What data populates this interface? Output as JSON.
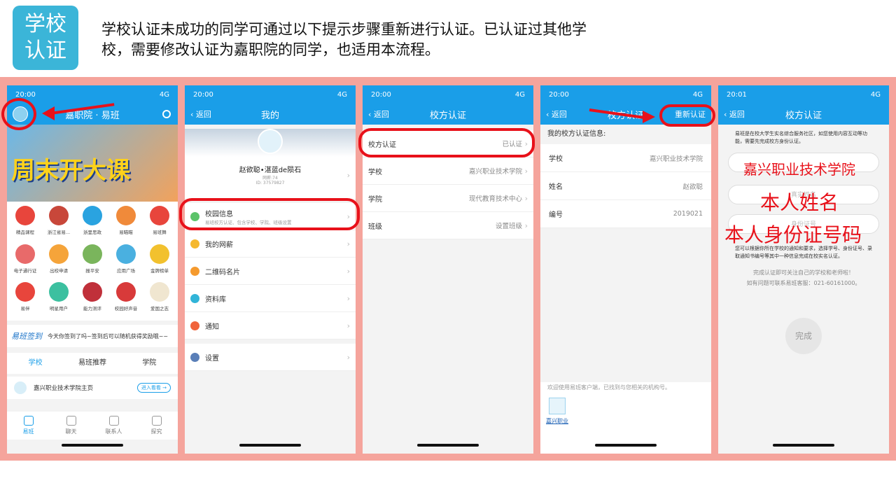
{
  "header": {
    "badge": "学校\n认证",
    "instructions": "学校认证未成功的同学可通过以下提示步骤重新进行认证。已认证过其他学校，需要修改认证为嘉职院的同学，也适用本流程。"
  },
  "status": {
    "time_1": "20:00",
    "time_5": "20:01",
    "net": "4G"
  },
  "phone1": {
    "title": "嘉职院 · 易班",
    "banner_text": "周末开大课",
    "grid": [
      "精品课程",
      "浙江省易...",
      "浙里思政",
      "易瞄瞄",
      "易班舞",
      "电子通行证",
      "出校申请",
      "报平安",
      "应用广场",
      "金牌榜单",
      "易伴",
      "明星用户",
      "能力测评",
      "校园好声音",
      "爱国之志"
    ],
    "sign_brand": "易班签到",
    "sign_text": "今天你签到了吗~签到后可以随机获得奖励哦~~",
    "tabs": [
      "学校",
      "易班推荐",
      "学院"
    ],
    "school_home": "嘉兴职业技术学院主页",
    "enter_btn": "进入看看 →",
    "bottom_nav": [
      "易班",
      "聊天",
      "联系人",
      "探究"
    ]
  },
  "phone2": {
    "back": "返回",
    "title": "我的",
    "name": "赵欲聪•湛蓝de陨石",
    "salary": "网薪:74",
    "id": "ID: 37579827",
    "menu": [
      {
        "label": "校园信息",
        "sub": "易班校方认证、包含学校、学院、班级设置",
        "color": "#5cc36a"
      },
      {
        "label": "我的网薪",
        "sub": "",
        "color": "#f5b82e"
      },
      {
        "label": "二维码名片",
        "sub": "",
        "color": "#f59a2e"
      },
      {
        "label": "资料库",
        "sub": "",
        "color": "#31b4d8"
      },
      {
        "label": "通知",
        "sub": "",
        "color": "#f0643c"
      },
      {
        "label": "设置",
        "sub": "",
        "color": "#5a7fb8"
      }
    ]
  },
  "phone3": {
    "back": "返回",
    "title": "校方认证",
    "rows": [
      {
        "label": "校方认证",
        "value": "已认证"
      },
      {
        "label": "学校",
        "value": "嘉兴职业技术学院"
      },
      {
        "label": "学院",
        "value": "现代教育技术中心"
      },
      {
        "label": "班级",
        "value": "设置班级"
      }
    ]
  },
  "phone4": {
    "back": "返回",
    "title": "校方认证",
    "reauth": "重新认证",
    "info_header": "我的校方认证信息:",
    "rows": [
      {
        "label": "学校",
        "value": "嘉兴职业技术学院"
      },
      {
        "label": "姓名",
        "value": "赵欲聪"
      },
      {
        "label": "编号",
        "value": "2019021"
      }
    ],
    "footer": "欢迎使用易班客户端，已找到与您相关的机构号。",
    "org": "嘉兴职业"
  },
  "phone5": {
    "back": "返回",
    "title": "校方认证",
    "intro": "易班是在校大学生实名综合服务社区，如您使用内容互动等功能，需要先完成校方身份认证。",
    "school_field": "嘉兴职业技术学院",
    "name_field": "真实姓名",
    "id_field": "身份证号",
    "note": "您可以根据你所在学校的通知和要求，选择学号、身份证号、录取通知书编号等其中一种信息完成在校实名认证。",
    "tip1": "完成认证即可关注自己的学校和老师啦！",
    "tip2": "如有问题可联系易班客服：021-60161000。",
    "done": "完成",
    "overlay_name": "本人姓名",
    "overlay_id": "本人身份证号码"
  }
}
